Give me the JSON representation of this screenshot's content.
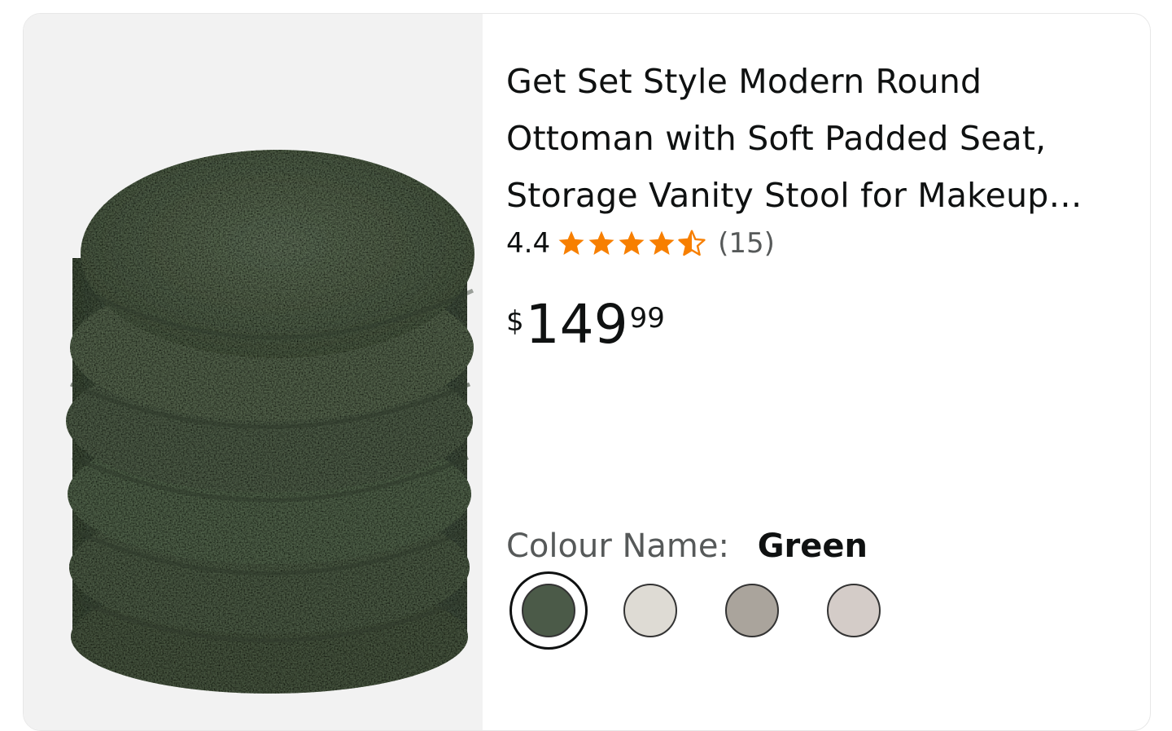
{
  "product": {
    "title_lines": [
      "Get Set Style Modern Round",
      "Ottoman with Soft Padded Seat,",
      "Storage Vanity Stool for Makeup…"
    ],
    "rating": "4.4",
    "rating_stars": 4.4,
    "review_count": "(15)",
    "price": {
      "symbol": "$",
      "whole": "149",
      "fraction": "99"
    },
    "colour": {
      "label": "Colour Name:",
      "selected": "Green",
      "swatches": [
        {
          "name": "green",
          "color": "#4b5a48",
          "selected": true
        },
        {
          "name": "cream",
          "color": "#dedbd4",
          "selected": false
        },
        {
          "name": "taupe",
          "color": "#aaa49c",
          "selected": false
        },
        {
          "name": "light-grey",
          "color": "#d4ccc8",
          "selected": false
        }
      ]
    }
  },
  "colors": {
    "star": "#f77f00",
    "ottoman": "#4e5d49"
  },
  "icons": {
    "star": "star-icon",
    "half_star": "half-star-icon"
  }
}
